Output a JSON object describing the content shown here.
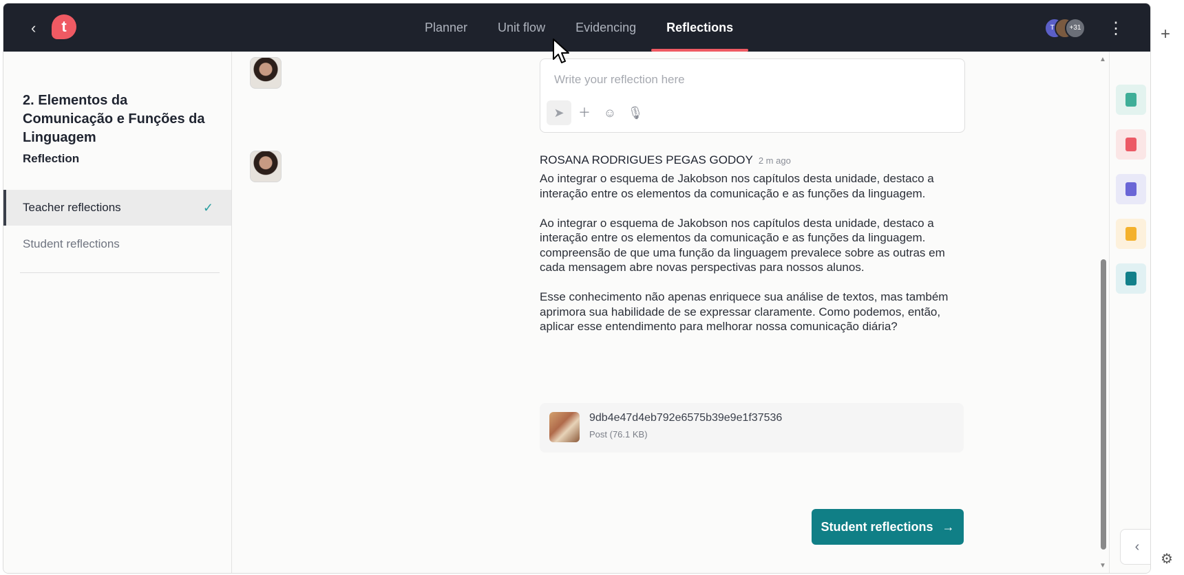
{
  "header": {
    "tabs": [
      {
        "label": "Planner"
      },
      {
        "label": "Unit flow"
      },
      {
        "label": "Evidencing"
      },
      {
        "label": "Reflections"
      }
    ],
    "active_tab": "Reflections",
    "logo_letter": "t",
    "avatars": [
      {
        "initials": "TS"
      },
      {
        "initials": ""
      },
      {
        "initials": "+31"
      }
    ]
  },
  "sidebar": {
    "unit_title": "2. Elementos da Comunicação e Funções da Linguagem",
    "items": [
      {
        "label": "Reflection"
      },
      {
        "label": "Teacher reflections"
      },
      {
        "label": "Student reflections"
      }
    ]
  },
  "composer": {
    "placeholder": "Write your reflection here"
  },
  "post": {
    "author": "ROSANA RODRIGUES PEGAS GODOY",
    "time": "2 m ago",
    "paragraphs": [
      "Ao integrar o esquema de Jakobson nos capítulos desta unidade, destaco a interação entre os elementos da comunicação e as funções da linguagem.",
      "Ao integrar o esquema de Jakobson nos capítulos desta unidade, destaco a interação entre os elementos da comunicação e as funções da linguagem. compreensão de que uma função da linguagem prevalece sobre as outras em cada mensagem abre novas perspectivas para nossos alunos.",
      "Esse conhecimento não apenas enriquece sua análise de textos, mas também aprimora sua habilidade de se expressar claramente. Como podemos, então, aplicar esse entendimento para melhorar nossa comunicação diária?"
    ],
    "attachment": {
      "name": "9db4e47d4eb792e6575b39e9e1f37536",
      "meta": "Post (76.1 KB)"
    }
  },
  "cta": {
    "label": "Student reflections",
    "arrow": "→"
  },
  "right_panel": {
    "buttons": [
      {
        "icon": "notes-icon",
        "bg": "#e3f3ef",
        "fg": "#3fae98"
      },
      {
        "icon": "clipboard-check-icon",
        "bg": "#fbe6e6",
        "fg": "#ec5a66"
      },
      {
        "icon": "le-icon",
        "bg": "#e9e9f8",
        "fg": "#6a66d6"
      },
      {
        "icon": "archive-icon",
        "bg": "#fdf1dc",
        "fg": "#f4b12c"
      },
      {
        "icon": "clipboard-icon",
        "bg": "#e1f1f3",
        "fg": "#13808a"
      }
    ]
  }
}
